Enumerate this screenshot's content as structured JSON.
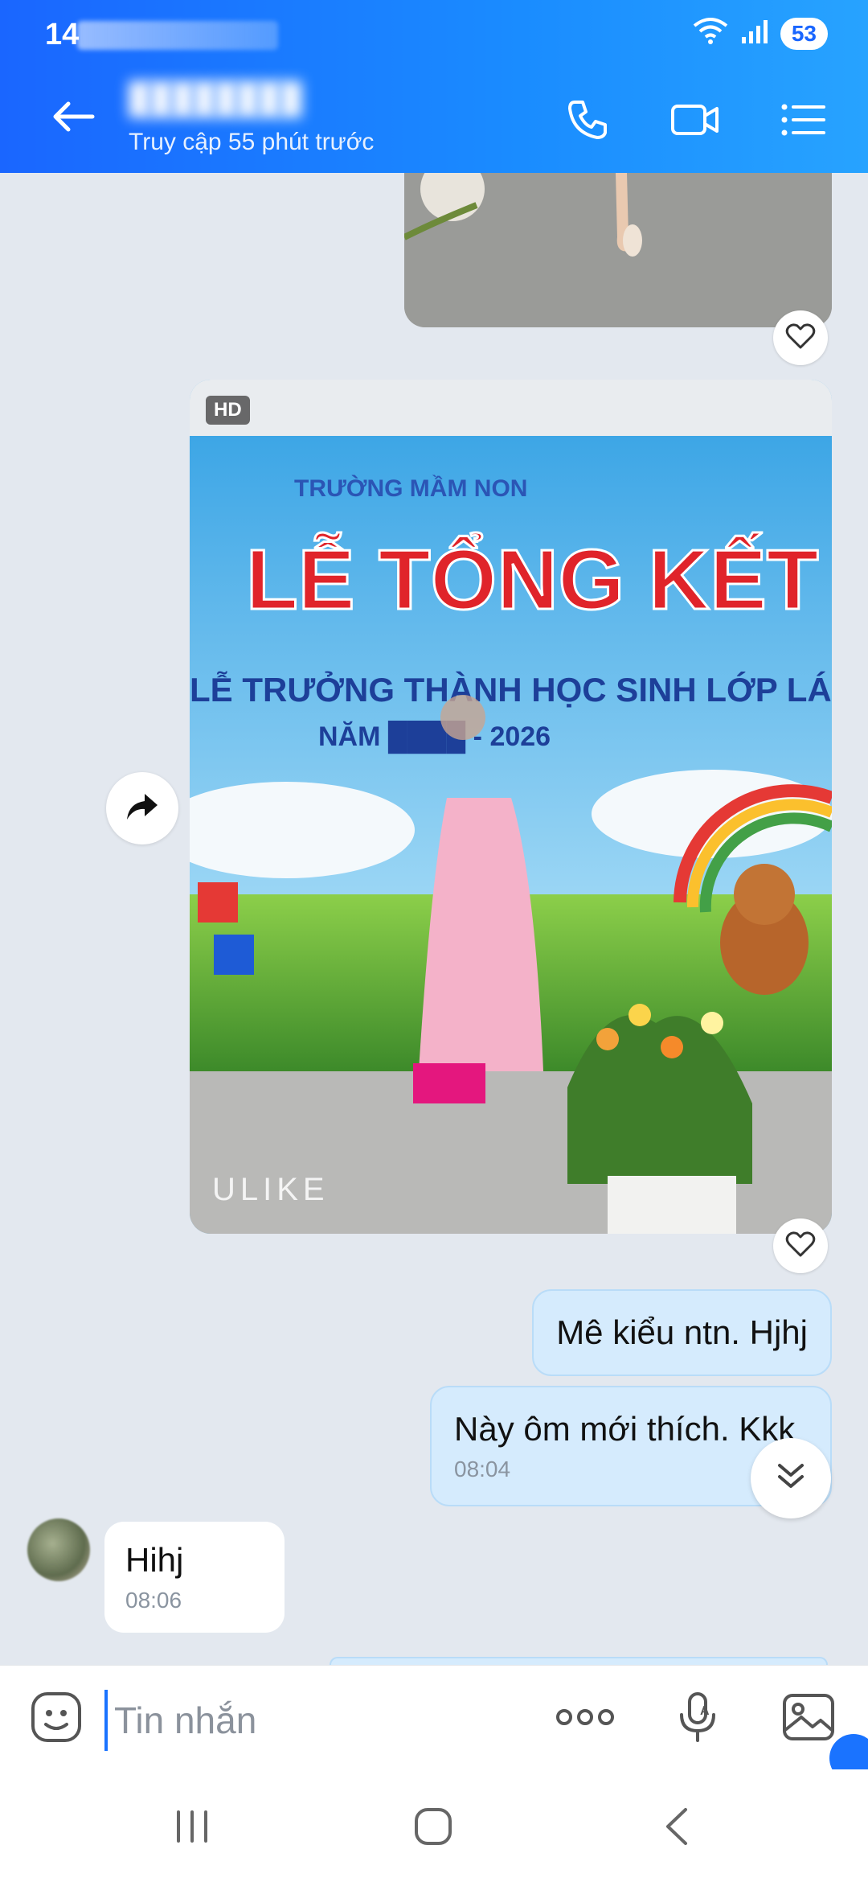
{
  "status_bar": {
    "time": "14",
    "battery": "53"
  },
  "header": {
    "contact_status": "Truy cập 55 phút trước"
  },
  "photo": {
    "badge": "HD",
    "caption": "ULIKE"
  },
  "messages": [
    {
      "text": "Mê kiểu ntn. Hjhj"
    },
    {
      "text": "Này ôm mới thích. Kkk",
      "time": "08:04"
    },
    {
      "text": "Hihj",
      "time": "08:06"
    }
  ],
  "composer": {
    "placeholder": "Tin nhắn"
  },
  "icons": {
    "back": "arrow-left-icon",
    "call": "phone-icon",
    "video": "video-camera-icon",
    "menu": "list-menu-icon",
    "emoji": "sticker-icon",
    "more": "more-dots-icon",
    "voice": "microphone-icon",
    "gallery": "image-icon"
  },
  "colors": {
    "header_blue": "#1a73ff",
    "bubble_out": "#d5ebfd",
    "chat_bg": "#e3e8ef"
  }
}
